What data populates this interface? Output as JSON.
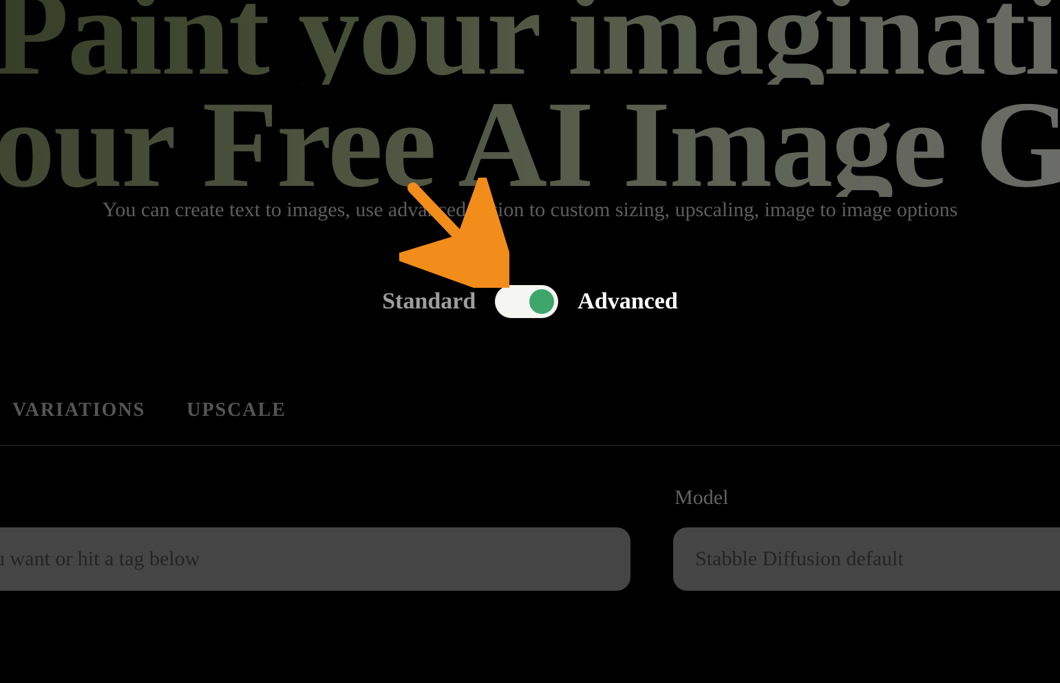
{
  "hero": {
    "line1": "Paint your imagination using",
    "line2": "our Free AI Image Generator"
  },
  "subtext": "You can create text to images, use advanced option to custom sizing, upscaling, image to image options",
  "toggle": {
    "left_label": "Standard",
    "right_label": "Advanced",
    "state_advanced": true
  },
  "tabs": {
    "variations": "VARIATIONS",
    "upscale": "UPSCALE"
  },
  "controls": {
    "model_label": "Model",
    "prompt_placeholder_fragment": "u want or hit a tag below",
    "model_selected": "Stabble Diffusion default"
  },
  "annotation": {
    "arrow_color": "#f28c1a"
  }
}
